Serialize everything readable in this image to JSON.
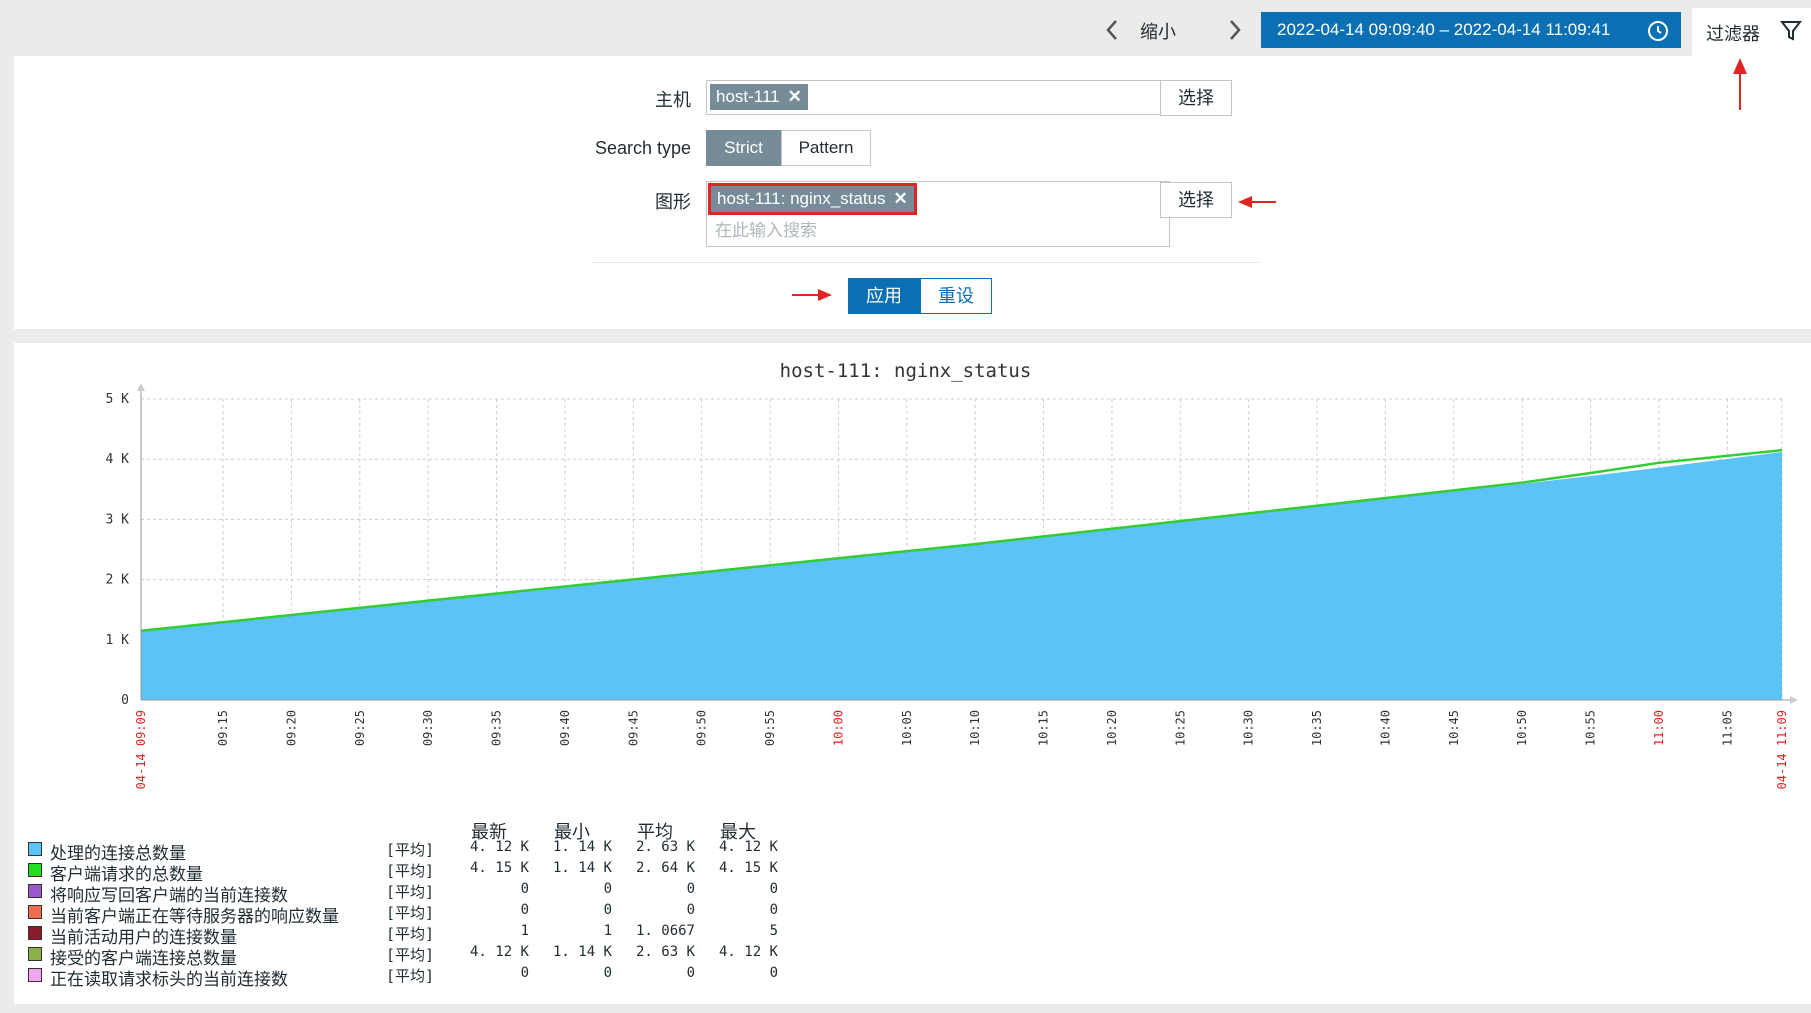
{
  "topbar": {
    "zoom_out_label": "缩小",
    "time_range": "2022-04-14 09:09:40 – 2022-04-14 11:09:41",
    "filter_tab_label": "过滤器"
  },
  "filter": {
    "host_label": "主机",
    "host_tag": "host-111",
    "host_select_label": "选择",
    "search_type_label": "Search type",
    "search_type_strict": "Strict",
    "search_type_pattern": "Pattern",
    "search_type_selected": "Strict",
    "graph_label": "图形",
    "graph_tag": "host-111: nginx_status",
    "graph_placeholder": "在此输入搜索",
    "graph_select_label": "选择",
    "apply_label": "应用",
    "reset_label": "重设"
  },
  "colors": {
    "accent": "#0a6fb3",
    "tag_bg": "#768d99",
    "highlight": "#e02323"
  },
  "chart_data": {
    "type": "area",
    "title": "host-111: nginx_status",
    "yticks": [
      "0",
      "1 K",
      "2 K",
      "3 K",
      "4 K",
      "5 K"
    ],
    "ylim": [
      0,
      5000
    ],
    "x_start_label": "04-14 09:09",
    "x_end_label": "04-14 11:09",
    "x_ticks": [
      "09:15",
      "09:20",
      "09:25",
      "09:30",
      "09:35",
      "09:40",
      "09:45",
      "09:50",
      "09:55",
      "10:00",
      "10:05",
      "10:10",
      "10:15",
      "10:20",
      "10:25",
      "10:30",
      "10:35",
      "10:40",
      "10:45",
      "10:50",
      "10:55",
      "11:00",
      "11:05"
    ],
    "x_ticks_red": [
      "10:00",
      "11:00"
    ],
    "x": [
      "09:09",
      "09:30",
      "09:50",
      "10:10",
      "10:30",
      "10:50",
      "10:55",
      "11:00",
      "11:09"
    ],
    "series": [
      {
        "name": "处理的连接总数量",
        "color": "#5bc3f5",
        "values": [
          1140,
          1640,
          2110,
          2580,
          3090,
          3590,
          3720,
          3860,
          4120
        ]
      },
      {
        "name": "客户端请求的总数量",
        "color": "#33cc33",
        "values": [
          1150,
          1650,
          2120,
          2590,
          3100,
          3610,
          3770,
          3940,
          4150
        ]
      }
    ],
    "grid": true,
    "legend_headers": [
      "最新",
      "最小",
      "平均",
      "最大"
    ],
    "legend": [
      {
        "name": "处理的连接总数量",
        "color": "#5bc3f5",
        "agg": "[平均]",
        "last": "4. 12 K",
        "min": "1. 14 K",
        "avg": "2. 63 K",
        "max": "4. 12 K"
      },
      {
        "name": "客户端请求的总数量",
        "color": "#22dd22",
        "agg": "[平均]",
        "last": "4. 15 K",
        "min": "1. 14 K",
        "avg": "2. 64 K",
        "max": "4. 15 K"
      },
      {
        "name": "将响应写回客户端的当前连接数",
        "color": "#9b59d0",
        "agg": "[平均]",
        "last": "0",
        "min": "0",
        "avg": "0",
        "max": "0"
      },
      {
        "name": "当前客户端正在等待服务器的响应数量",
        "color": "#f26c4f",
        "agg": "[平均]",
        "last": "0",
        "min": "0",
        "avg": "0",
        "max": "0"
      },
      {
        "name": "当前活动用户的连接数量",
        "color": "#8b1a2b",
        "agg": "[平均]",
        "last": "1",
        "min": "1",
        "avg": "1. 0667",
        "max": "5"
      },
      {
        "name": "接受的客户端连接总数量",
        "color": "#8cb04a",
        "agg": "[平均]",
        "last": "4. 12 K",
        "min": "1. 14 K",
        "avg": "2. 63 K",
        "max": "4. 12 K"
      },
      {
        "name": "正在读取请求标头的当前连接数",
        "color": "#f2a6f2",
        "agg": "[平均]",
        "last": "0",
        "min": "0",
        "avg": "0",
        "max": "0"
      }
    ]
  }
}
